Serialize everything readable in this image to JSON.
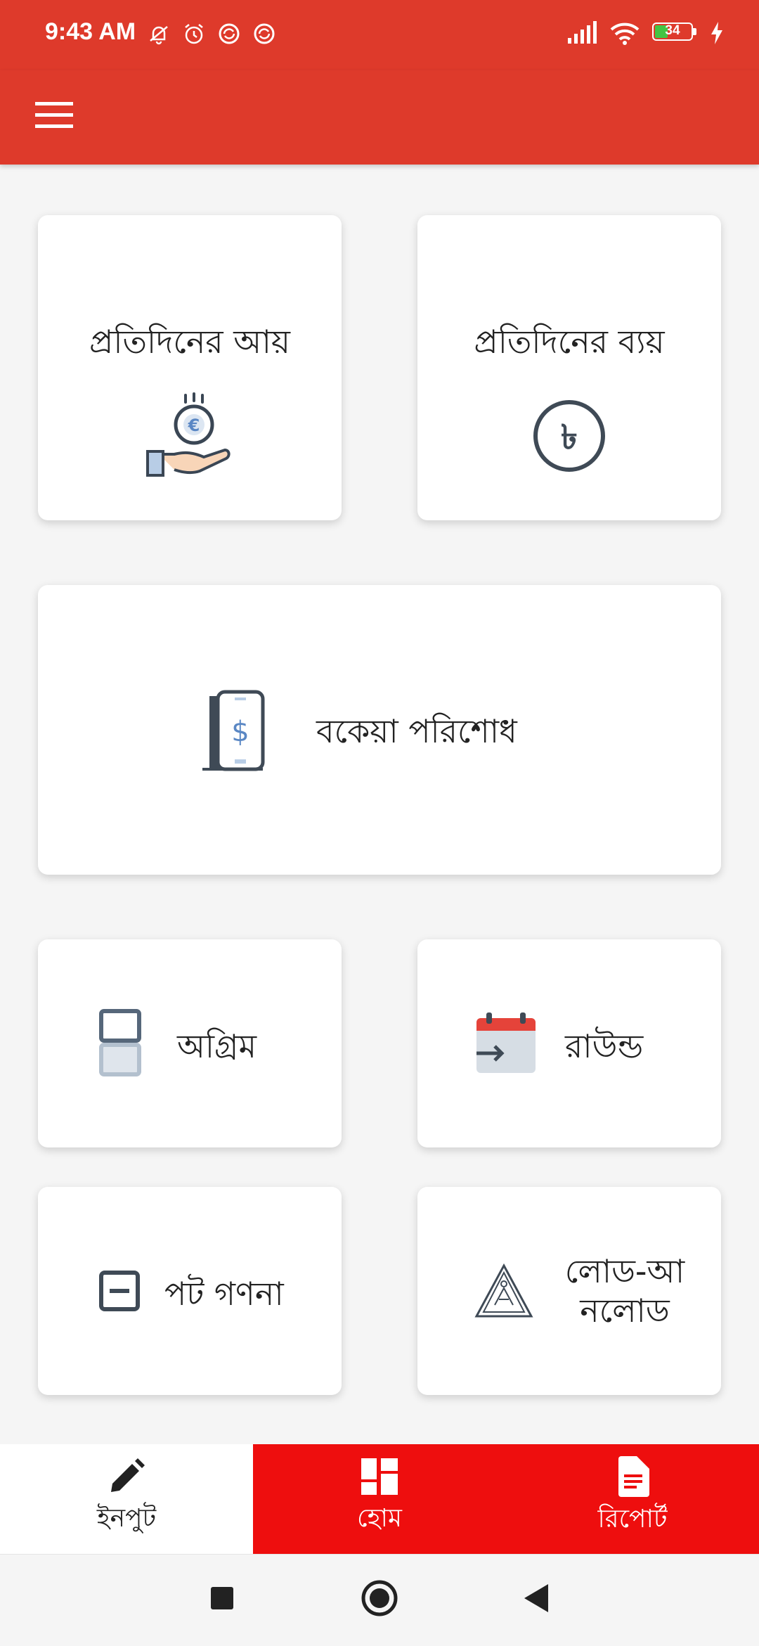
{
  "status_bar": {
    "time": "9:43 AM",
    "battery": "34",
    "icons_left": [
      "muted-bell-icon",
      "alarm-icon",
      "sync-icon",
      "sync-icon"
    ],
    "icons_right": [
      "signal-icon",
      "wifi-icon",
      "battery-icon",
      "charging-icon"
    ]
  },
  "app_bar": {
    "menu_icon": "hamburger-menu-icon"
  },
  "cards": {
    "daily_income": {
      "label": "প্রতিদিনের আয়",
      "icon": "hand-coin-euro-icon"
    },
    "daily_expense": {
      "label": "প্রতিদিনের ব্যয়",
      "icon": "taka-coin-icon"
    },
    "due_payment": {
      "label": "বকেয়া পরিশোধ",
      "icon": "phone-dollar-icon"
    },
    "advance": {
      "label": "অগ্রিম",
      "icon": "stacked-boxes-icon"
    },
    "round": {
      "label": "রাউন্ড",
      "icon": "calendar-arrow-icon"
    },
    "pot_count": {
      "label": "পট গণনা",
      "icon": "minus-box-icon"
    },
    "load_unload": {
      "label_line1": "লোড-আ",
      "label_line2": "নলোড",
      "icon": "warning-sign-icon"
    }
  },
  "tabs": [
    {
      "label": "ইনপুট",
      "icon": "pencil-icon",
      "active": true
    },
    {
      "label": "হোম",
      "icon": "dashboard-icon",
      "active": false
    },
    {
      "label": "রিপোর্ট",
      "icon": "document-icon",
      "active": false
    }
  ],
  "colors": {
    "primary": "#de3a2b",
    "tab_red": "#ee0e0e",
    "card_bg": "#ffffff",
    "page_bg": "#f5f5f5"
  }
}
